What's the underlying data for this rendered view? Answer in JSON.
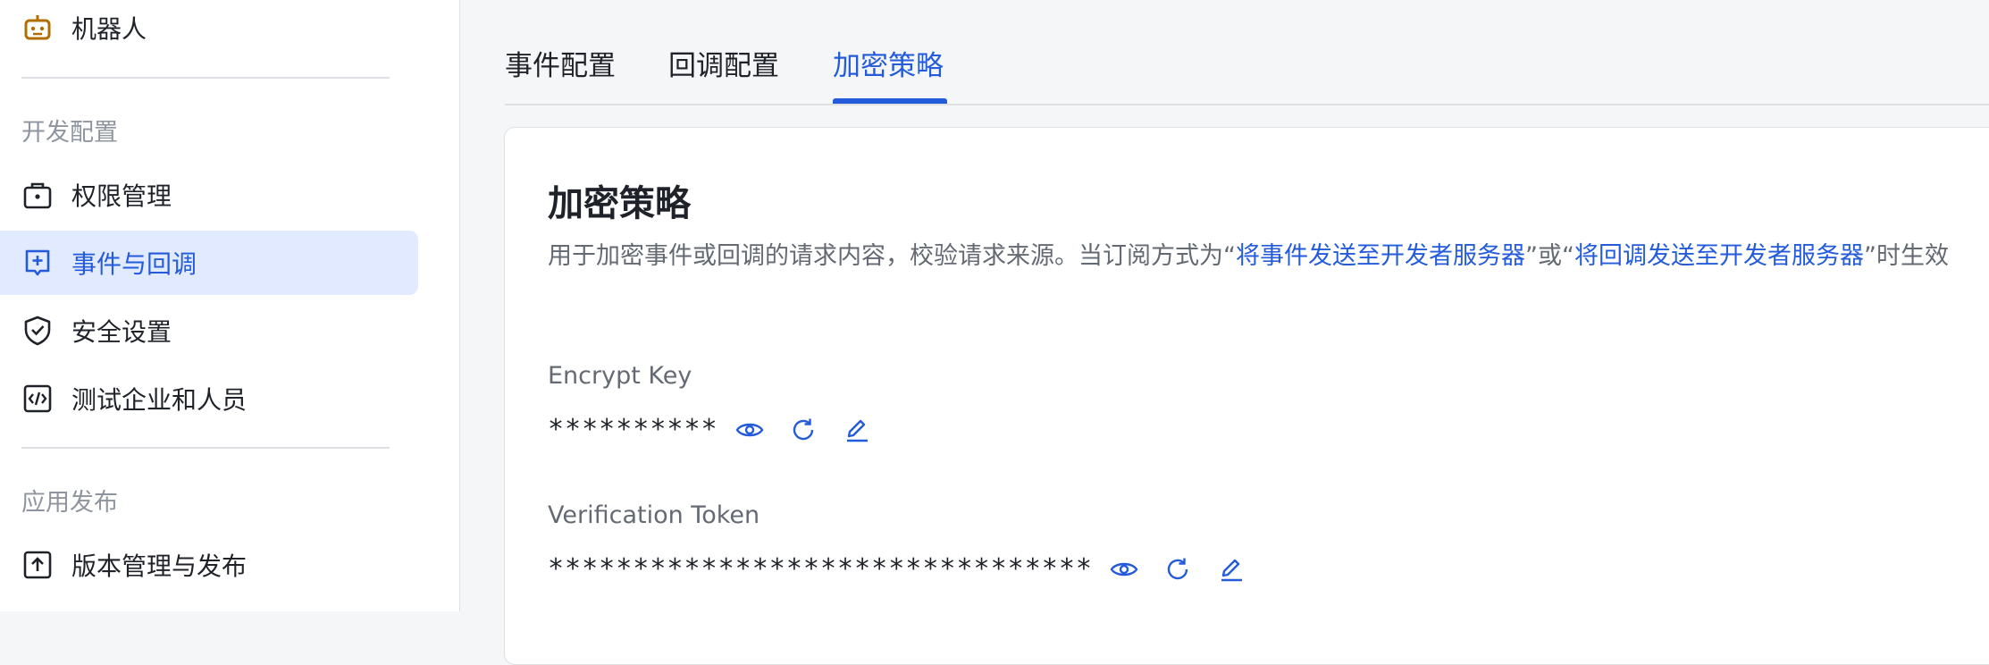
{
  "sidebar": {
    "top_item": {
      "label": "机器人",
      "icon": "robot-icon"
    },
    "sections": [
      {
        "title": "开发配置"
      },
      {
        "title": "应用发布"
      }
    ],
    "items": [
      {
        "label": "权限管理",
        "icon": "briefcase-lock-icon"
      },
      {
        "label": "事件与回调",
        "icon": "event-plus-icon",
        "active": true
      },
      {
        "label": "安全设置",
        "icon": "shield-check-icon"
      },
      {
        "label": "测试企业和人员",
        "icon": "code-box-icon"
      },
      {
        "label": "版本管理与发布",
        "icon": "upload-box-icon"
      }
    ]
  },
  "tabs": [
    {
      "label": "事件配置"
    },
    {
      "label": "回调配置"
    },
    {
      "label": "加密策略",
      "active": true
    }
  ],
  "card": {
    "title": "加密策略",
    "desc_part1": "用于加密事件或回调的请求内容，校验请求来源。当订阅方式为“",
    "desc_link1": "将事件发送至开发者服务器",
    "desc_part2": "”或“",
    "desc_link2": "将回调发送至开发者服务器",
    "desc_part3": "”时生效",
    "fields": [
      {
        "label": "Encrypt Key",
        "value": "**********"
      },
      {
        "label": "Verification Token",
        "value": "********************************"
      }
    ]
  },
  "colors": {
    "accent": "#245bdb",
    "active_bg": "#e1eaff",
    "muted": "#8f959e",
    "text": "#1f2329"
  }
}
